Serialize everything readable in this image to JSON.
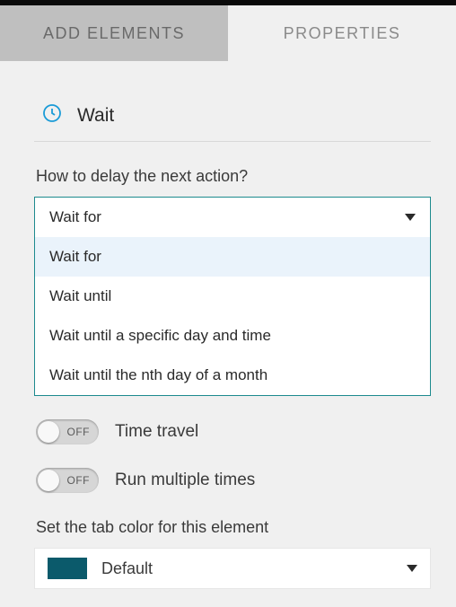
{
  "tabs": {
    "add_elements": "ADD ELEMENTS",
    "properties": "PROPERTIES"
  },
  "section": {
    "title": "Wait"
  },
  "delay": {
    "label": "How to delay the next action?",
    "selected": "Wait for",
    "options": [
      "Wait for",
      "Wait until",
      "Wait until a specific day and time",
      "Wait until the nth day of a month"
    ]
  },
  "toggles": {
    "time_travel": {
      "state": "OFF",
      "label": "Time travel"
    },
    "run_multiple": {
      "state": "OFF",
      "label": "Run multiple times"
    }
  },
  "color": {
    "label": "Set the tab color for this element",
    "selected_label": "Default",
    "swatch": "#0b5a6b"
  }
}
